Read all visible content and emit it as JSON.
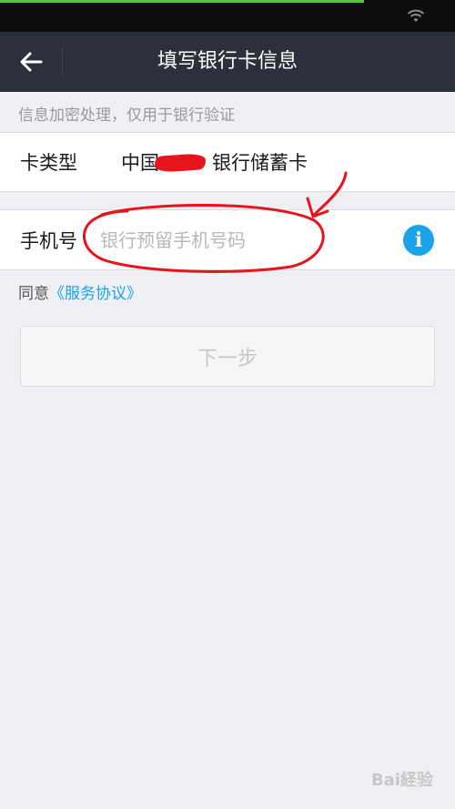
{
  "header": {
    "title": "填写银行卡信息",
    "back_icon": "arrow-left-icon"
  },
  "hint": "信息加密处理，仅用于银行验证",
  "card_row": {
    "label": "卡类型",
    "value": "中国",
    "value_suffix": "银行储蓄卡"
  },
  "phone_row": {
    "label": "手机号",
    "placeholder": "银行预留手机号码",
    "value": "",
    "info_icon": "info-icon",
    "info_glyph": "i"
  },
  "agreement": {
    "prefix": "同意",
    "link": "《服务协议》"
  },
  "next_button": "下一步",
  "watermark": "Bai経验",
  "colors": {
    "nav_bg": "#2b303c",
    "accent_blue": "#1aa3e8",
    "annotation_red": "#e8141c",
    "page_bg": "#efeff4"
  }
}
